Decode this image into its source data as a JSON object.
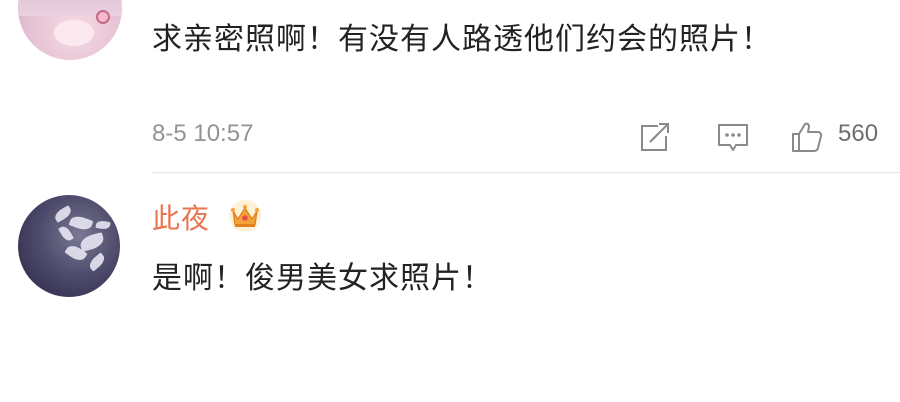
{
  "comments": [
    {
      "text": "求亲密照啊！有没有人路透他们约会的照片！",
      "timestamp": "8-5 10:57",
      "like_count": "560"
    },
    {
      "username": "此夜",
      "text": "是啊！俊男美女求照片！",
      "badge_icon": "crown-icon"
    }
  ],
  "colors": {
    "username": "#eb7350",
    "text": "#222222",
    "meta": "#939393",
    "icon": "#8a8a8a"
  }
}
